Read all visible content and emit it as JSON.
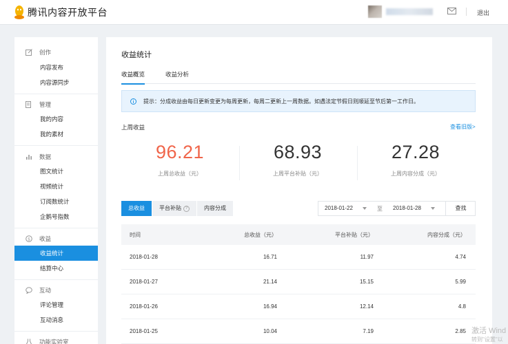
{
  "header": {
    "app_title": "腾讯内容开放平台",
    "logout_label": "退出"
  },
  "sidebar": {
    "groups": [
      {
        "label": "创作",
        "items": [
          "内容发布",
          "内容源同步"
        ]
      },
      {
        "label": "管理",
        "items": [
          "我的内容",
          "我的素材"
        ]
      },
      {
        "label": "数据",
        "items": [
          "图文统计",
          "视频统计",
          "订阅数统计",
          "企鹅号指数"
        ]
      },
      {
        "label": "收益",
        "items": [
          "收益统计",
          "结算中心"
        ]
      },
      {
        "label": "互动",
        "items": [
          "评论管理",
          "互动消息"
        ]
      },
      {
        "label": "功能实验室",
        "items": []
      }
    ],
    "active_item": "收益统计"
  },
  "main": {
    "title": "收益统计",
    "tabs": [
      "收益概览",
      "收益分析"
    ],
    "notice": "提示：分成收益由每日更新变更为每周更新，每周二更新上一周数据。如遇法定节假日则顺延至节后第一工作日。",
    "section_label": "上周收益",
    "old_version_link": "查看旧版>",
    "stats": [
      {
        "value": "96.21",
        "label": "上周总收益（元）"
      },
      {
        "value": "68.93",
        "label": "上周平台补贴（元）"
      },
      {
        "value": "27.28",
        "label": "上周内容分成（元）"
      }
    ],
    "filters": [
      "总收益",
      "平台补贴",
      "内容分成"
    ],
    "date_start": "2018-01-22",
    "date_separator": "至",
    "date_end": "2018-01-28",
    "search_label": "查找",
    "table": {
      "headers": [
        "时间",
        "总收益（元）",
        "平台补贴（元）",
        "内容分成（元）"
      ],
      "rows": [
        [
          "2018-01-28",
          "16.71",
          "11.97",
          "4.74"
        ],
        [
          "2018-01-27",
          "21.14",
          "15.15",
          "5.99"
        ],
        [
          "2018-01-26",
          "16.94",
          "12.14",
          "4.8"
        ],
        [
          "2018-01-25",
          "10.04",
          "7.19",
          "2.85"
        ]
      ]
    }
  },
  "overlay": {
    "line1": "激活 Wind",
    "line2": "转到\"设置\"以"
  },
  "colors": {
    "accent": "#1a8fe0",
    "highlight_value": "#f0654a"
  }
}
